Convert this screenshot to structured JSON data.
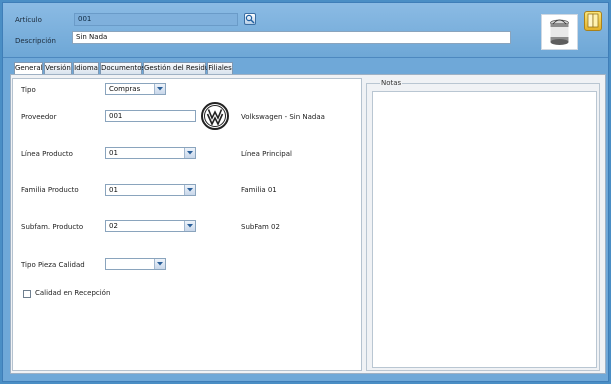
{
  "header": {
    "articulo_label": "Artículo",
    "articulo_value": "001",
    "descripcion_label": "Descripción",
    "descripcion_value": "Sin Nada"
  },
  "tabs": [
    {
      "label": "General"
    },
    {
      "label": "Versión"
    },
    {
      "label": "Idioma"
    },
    {
      "label": "Documentos"
    },
    {
      "label": "Gestión del Residuo"
    },
    {
      "label": "Filiales"
    }
  ],
  "form": {
    "tipo": {
      "label": "Tipo",
      "value": "Compras"
    },
    "proveedor": {
      "label": "Proveedor",
      "value": "001",
      "description": "Volkswagen - Sin Nadaa"
    },
    "linea": {
      "label": "Línea Producto",
      "value": "01",
      "description": "Línea Principal"
    },
    "familia": {
      "label": "Familia Producto",
      "value": "01",
      "description": "Familia 01"
    },
    "subfam": {
      "label": "Subfam. Producto",
      "value": "02",
      "description": "SubFam 02"
    },
    "tipo_pieza": {
      "label": "Tipo Pieza Calidad",
      "value": ""
    },
    "calidad": {
      "label": "Calidad en Recepción",
      "checked": false
    }
  },
  "notes": {
    "legend": "Notas",
    "value": ""
  },
  "icons": {
    "search": "magnifier-icon",
    "product": "paint-can-icon",
    "help": "book-icon",
    "supplier_logo": "volkswagen-logo-icon"
  }
}
